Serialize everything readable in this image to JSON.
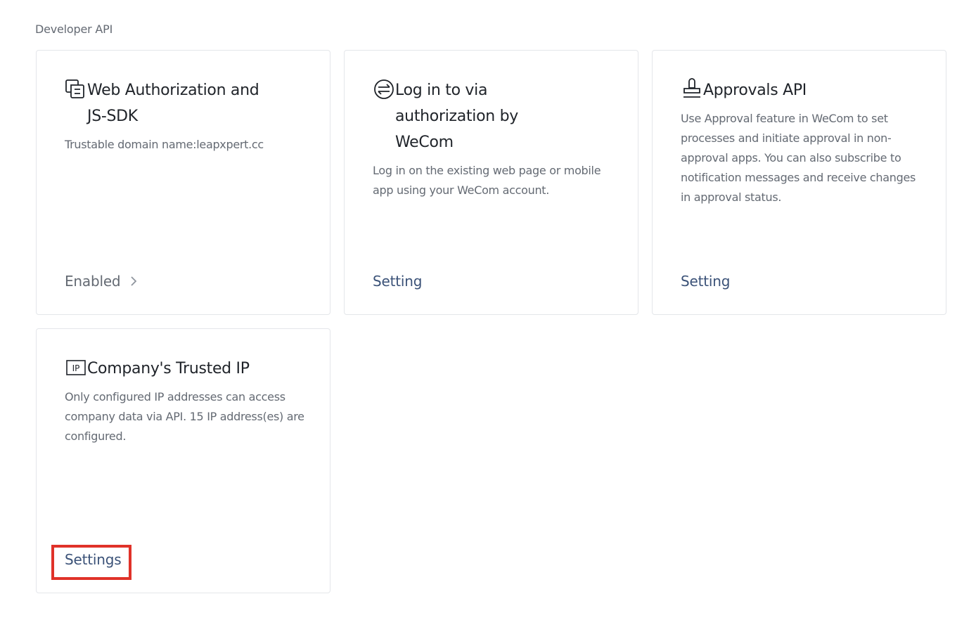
{
  "section": {
    "title": "Developer API"
  },
  "cards": [
    {
      "icon": "window-copy-icon",
      "title": "Web Authorization and JS-SDK",
      "description": "Trustable domain name:leapxpert.cc",
      "action": "Enabled"
    },
    {
      "icon": "login-circle-icon",
      "title": "Log in to via authorization by WeCom",
      "description": "Log in on the existing web page or mobile app using your WeCom account.",
      "action": "Setting"
    },
    {
      "icon": "stamp-icon",
      "title": "Approvals API",
      "description": "Use Approval feature in WeCom to set processes and initiate approval in non-approval apps. You can also subscribe to notification messages and receive changes in approval status.",
      "action": "Setting"
    },
    {
      "icon": "ip-badge-icon",
      "title": "Company's Trusted IP",
      "description": "Only configured IP addresses can access company data via API. 15 IP address(es) are configured.",
      "action": "Settings"
    }
  ],
  "colors": {
    "link": "#3b5278",
    "muted": "#646a73",
    "highlight": "#e03229",
    "border": "#e4e6ea"
  }
}
